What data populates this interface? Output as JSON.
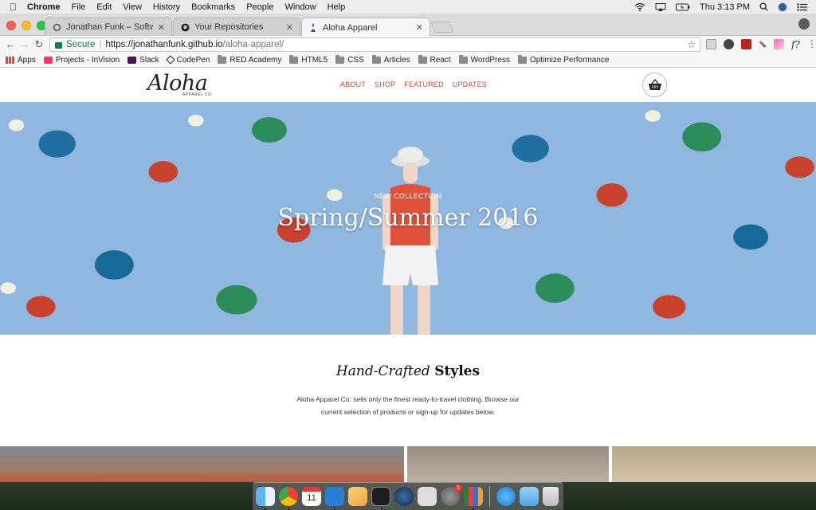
{
  "menubar": {
    "app_name": "Chrome",
    "items": [
      "File",
      "Edit",
      "View",
      "History",
      "Bookmarks",
      "People",
      "Window",
      "Help"
    ],
    "clock": "Thu 3:13 PM"
  },
  "tabs": [
    {
      "title": "Jonathan Funk – Software Dev",
      "icon": "site-icon",
      "active": false
    },
    {
      "title": "Your Repositories",
      "icon": "github-icon",
      "active": false
    },
    {
      "title": "Aloha Apparel",
      "icon": "aloha-icon",
      "active": true
    }
  ],
  "address": {
    "secure_label": "Secure",
    "url_scheme_host": "https://jonathanfunk.github.io",
    "url_path": "/aloha-apparel/"
  },
  "bookmarks": [
    {
      "label": "Apps",
      "icon": "apps-grid-icon"
    },
    {
      "label": "Projects - InVision",
      "icon": "invision-icon"
    },
    {
      "label": "Slack",
      "icon": "slack-icon"
    },
    {
      "label": "CodePen",
      "icon": "codepen-icon"
    },
    {
      "label": "RED Academy",
      "icon": "folder-icon"
    },
    {
      "label": "HTML5",
      "icon": "folder-icon"
    },
    {
      "label": "CSS",
      "icon": "folder-icon"
    },
    {
      "label": "Articles",
      "icon": "folder-icon"
    },
    {
      "label": "React",
      "icon": "folder-icon"
    },
    {
      "label": "WordPress",
      "icon": "folder-icon"
    },
    {
      "label": "Optimize Performance",
      "icon": "folder-icon"
    }
  ],
  "site": {
    "logo": "Aloha",
    "logo_sub": "APPAREL CO.",
    "nav": [
      "ABOUT",
      "SHOP",
      "FEATURED",
      "UPDATES"
    ],
    "hero_eyebrow": "NEW COLLECTION",
    "hero_title": "Spring/Summer 2016",
    "intro_title_em": "Hand-Crafted",
    "intro_title_strong": "Styles",
    "intro_text": "Aloha Apparel Co. sells only the finest ready-to-travel clothing. Browse our current selection of products or sign-up for updates below."
  },
  "dock": {
    "apps": [
      "finder-icon",
      "chrome-icon",
      "calendar-icon",
      "vscode-icon",
      "sketch-icon",
      "terminal-icon",
      "steam-icon",
      "sequel-pro-icon",
      "system-preferences-icon",
      "activity-monitor-icon",
      "app-store-icon",
      "downloads-folder-icon",
      "trash-icon"
    ],
    "calendar_day": "11",
    "badge": "1"
  },
  "colors": {
    "accent": "#e2432e",
    "secure_green": "#0b8043",
    "hero_bg": "#8fb7e0"
  }
}
